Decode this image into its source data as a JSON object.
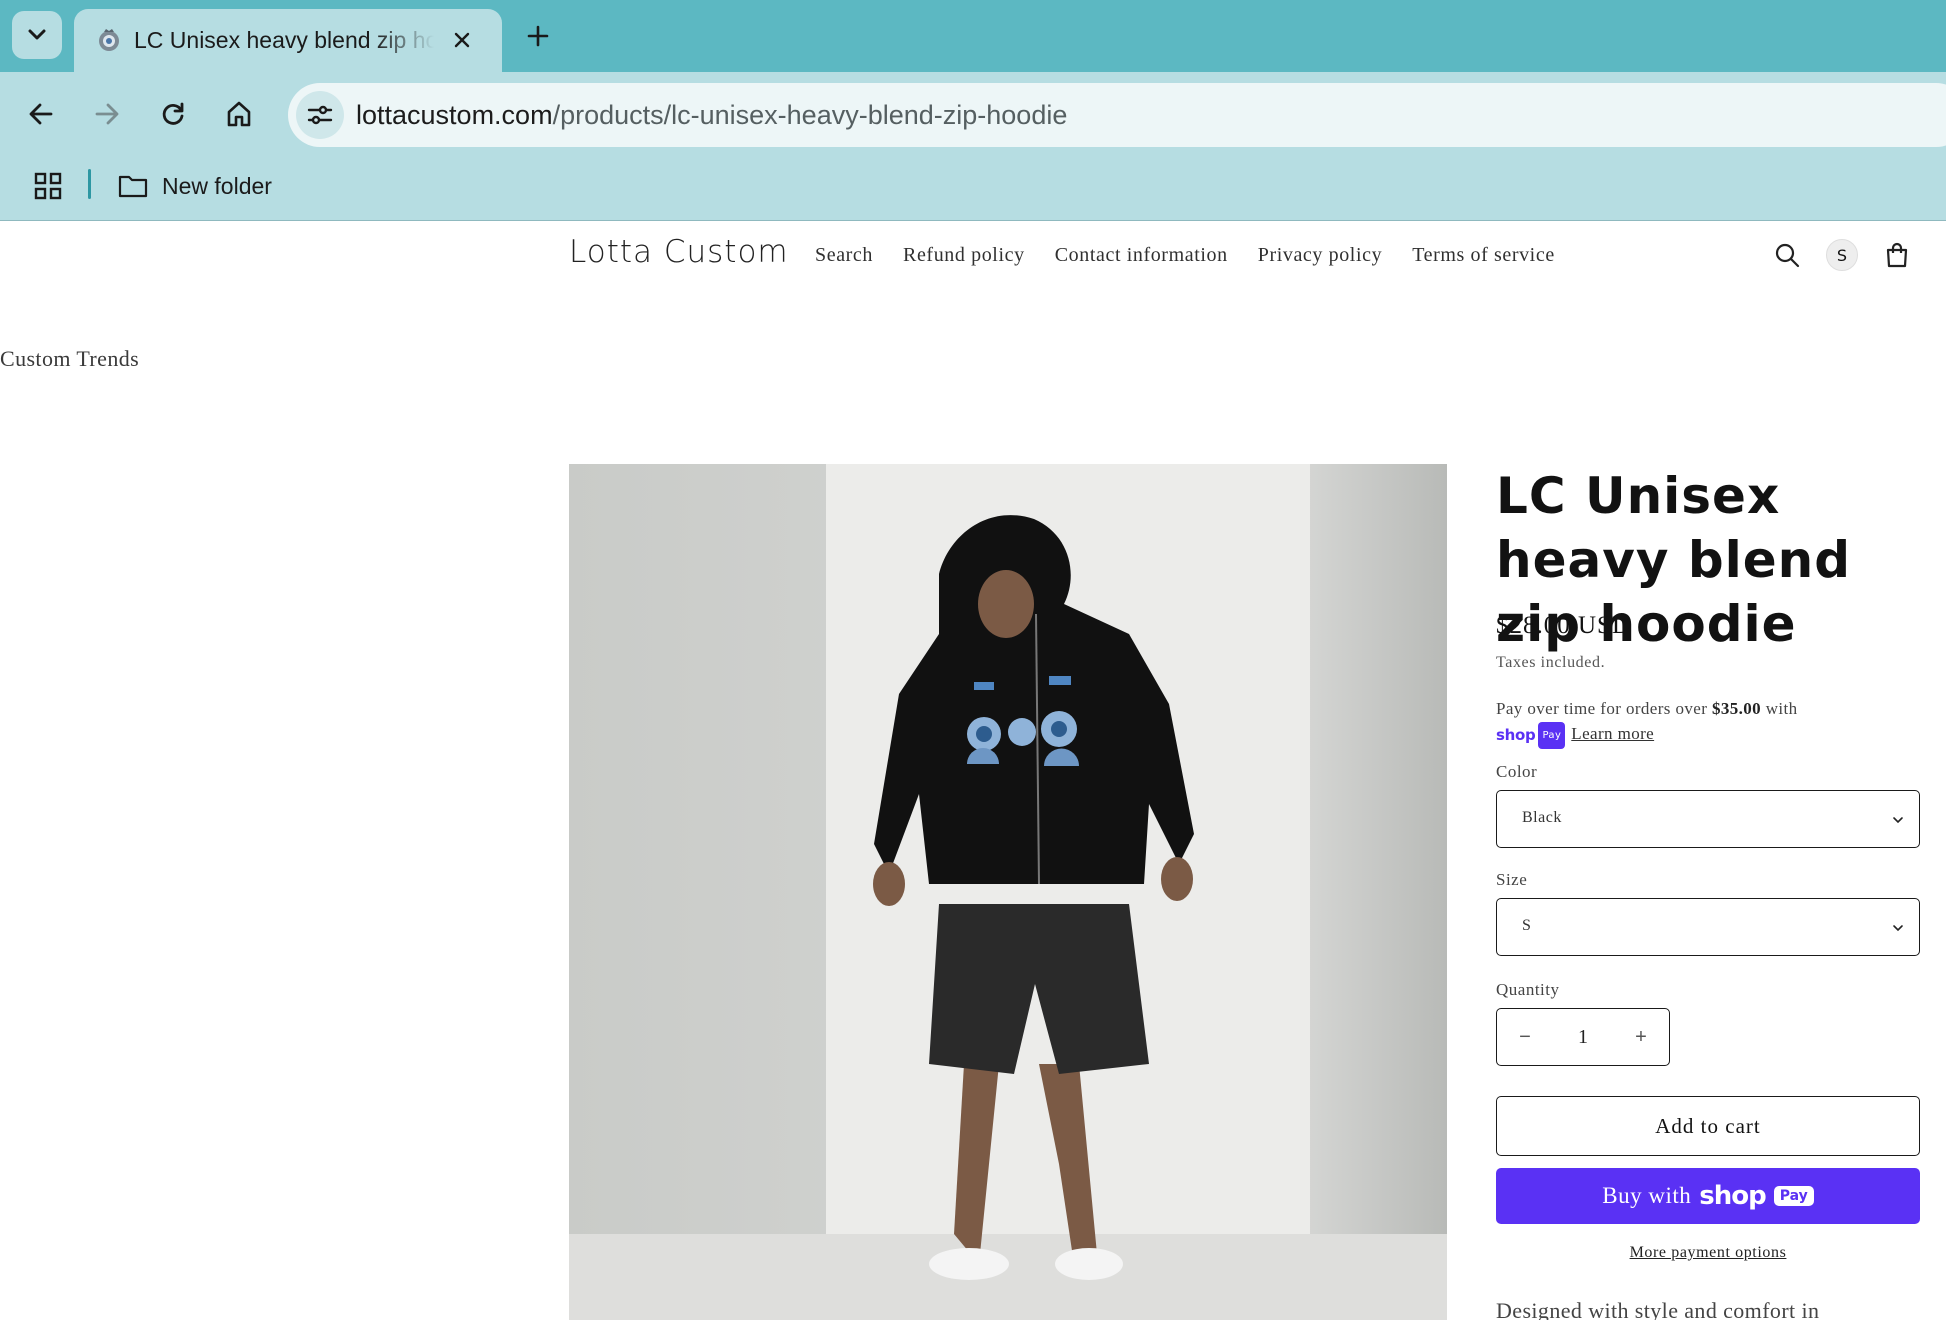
{
  "browser": {
    "tab": {
      "title": "LC Unisex heavy blend zip hoodie",
      "favicon": "store-logo-icon"
    },
    "address_bar": {
      "domain": "lottacustom.com",
      "path": "/products/lc-unisex-heavy-blend-zip-hoodie"
    },
    "bookmarks": [
      {
        "label": "New folder",
        "icon": "folder-icon"
      }
    ],
    "colors": {
      "frame": "#5cb8c2",
      "toolbar": "#b6dde2"
    }
  },
  "store": {
    "name": "Lotta Custom",
    "menu": [
      "Search",
      "Refund policy",
      "Contact information",
      "Privacy policy",
      "Terms of service"
    ],
    "account_initial": "S",
    "announcement": "Custom Trends"
  },
  "product": {
    "title": "LC Unisex heavy blend zip hoodie",
    "price": "$28.00 USD",
    "tax_note": "Taxes included.",
    "installments": {
      "prefix": "Pay over time for orders over ",
      "amount": "$35.00",
      "suffix": " with",
      "shop_word": "shop",
      "pay_word": "Pay",
      "learn_more": "Learn more"
    },
    "options": {
      "color_label": "Color",
      "color_value": "Black",
      "size_label": "Size",
      "size_value": "S"
    },
    "quantity_label": "Quantity",
    "quantity": "1",
    "qty_minus": "−",
    "qty_plus": "+",
    "add_to_cart": "Add to cart",
    "buy_now": {
      "label": "Buy with",
      "shop": "shop",
      "pay": "Pay"
    },
    "more_payment": "More payment options",
    "description_start": "Designed with style and comfort in"
  },
  "colors": {
    "shop_pay_purple": "#5a31f4"
  }
}
